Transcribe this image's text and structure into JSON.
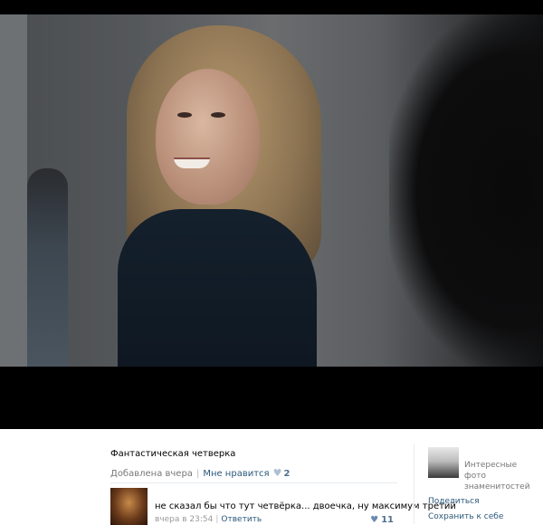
{
  "photo": {
    "caption": "Фантастическая четверка",
    "added": "Добавлена вчера",
    "like_label": "Мне нравится",
    "like_count": "2"
  },
  "comment": {
    "text": "не сказал бы что тут четвёрка... двоечка, ну максимум третий",
    "time": "вчера в 23:54",
    "reply_label": "Ответить",
    "like_count": "11"
  },
  "sidebar": {
    "album_title": "Интересные фото знаменитостей",
    "share_label": "Поделиться",
    "save_label": "Сохранить к себе"
  },
  "icons": {
    "like": "heart-icon",
    "sep": "|"
  },
  "colors": {
    "link": "#2b587a",
    "muted": "#777777",
    "divider": "#e7ebf0",
    "viewer_bg": "#000000"
  }
}
